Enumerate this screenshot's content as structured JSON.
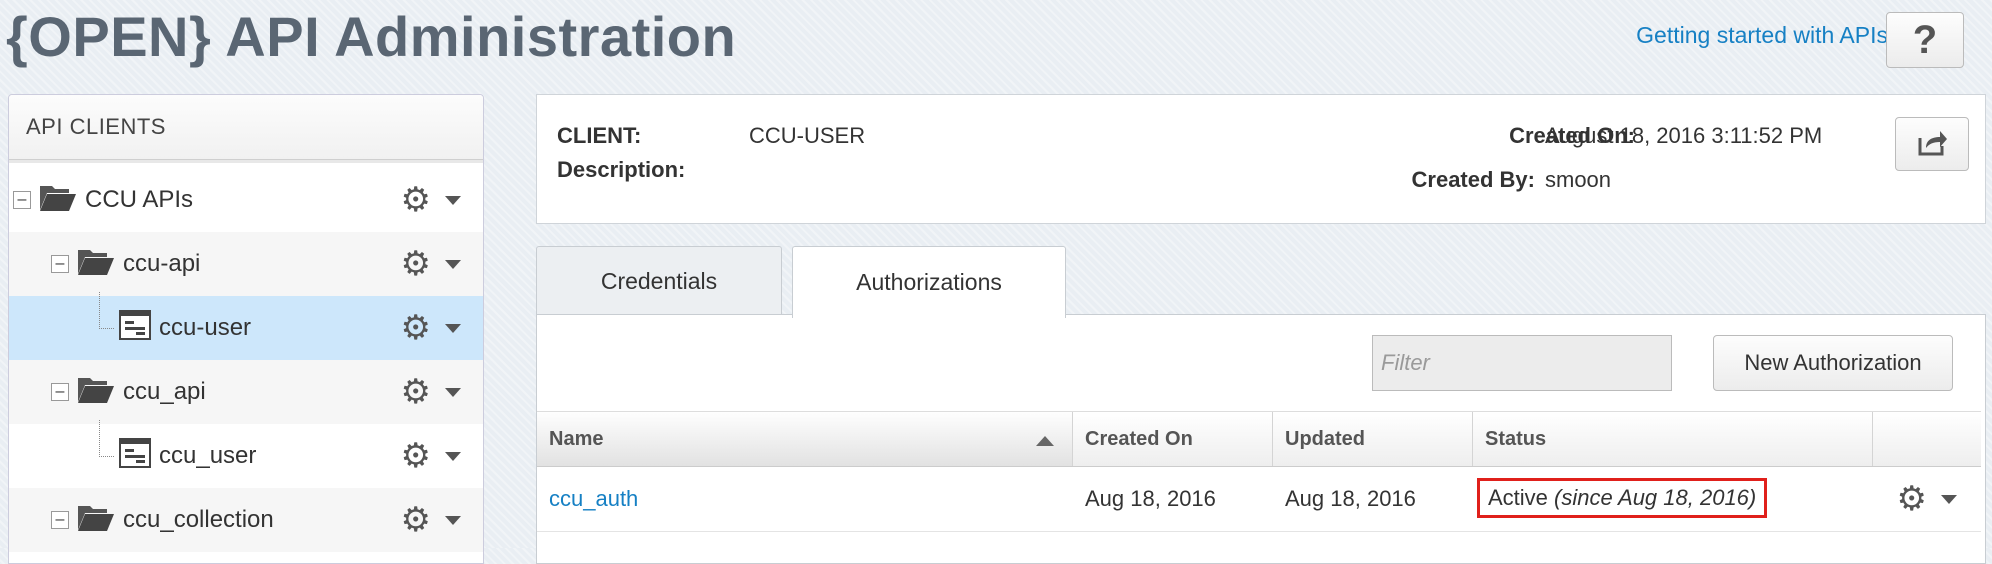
{
  "header": {
    "title": "{OPEN} API Administration",
    "help_link": "Getting started with APIs",
    "help_button": "?"
  },
  "left_panel": {
    "title": "API CLIENTS",
    "tree": [
      {
        "label": "CCU APIs",
        "type": "folder",
        "expander": "–"
      },
      {
        "label": "ccu-api",
        "type": "folder",
        "expander": "–"
      },
      {
        "label": "ccu-user",
        "type": "client",
        "selected": true
      },
      {
        "label": "ccu_api",
        "type": "folder",
        "expander": "–"
      },
      {
        "label": "ccu_user",
        "type": "client"
      },
      {
        "label": "ccu_collection",
        "type": "folder",
        "expander": "–"
      }
    ]
  },
  "client": {
    "client_label": "CLIENT:",
    "client_value": "CCU-USER",
    "description_label": "Description:",
    "description_value": "",
    "created_on_label": "Created On:",
    "created_on_value": "August 18, 2016 3:11:52 PM",
    "created_by_label": "Created By:",
    "created_by_value": "smoon"
  },
  "tabs": [
    {
      "label": "Credentials",
      "active": false
    },
    {
      "label": "Authorizations",
      "active": true
    }
  ],
  "authorizations": {
    "filter_placeholder": "Filter",
    "new_button": "New Authorization",
    "columns": [
      "Name",
      "Created On",
      "Updated",
      "Status"
    ],
    "sort": {
      "column": "Name",
      "direction": "ascending"
    },
    "rows": [
      {
        "name": "ccu_auth",
        "created_on": "Aug 18, 2016",
        "updated": "Aug 18, 2016",
        "status": "Active",
        "status_since": "(since Aug 18, 2016)"
      }
    ]
  },
  "colors": {
    "title": "#5a6673",
    "link": "#1680c4",
    "selected_row": "#cde7fb",
    "highlight_box": "#e0201b"
  }
}
